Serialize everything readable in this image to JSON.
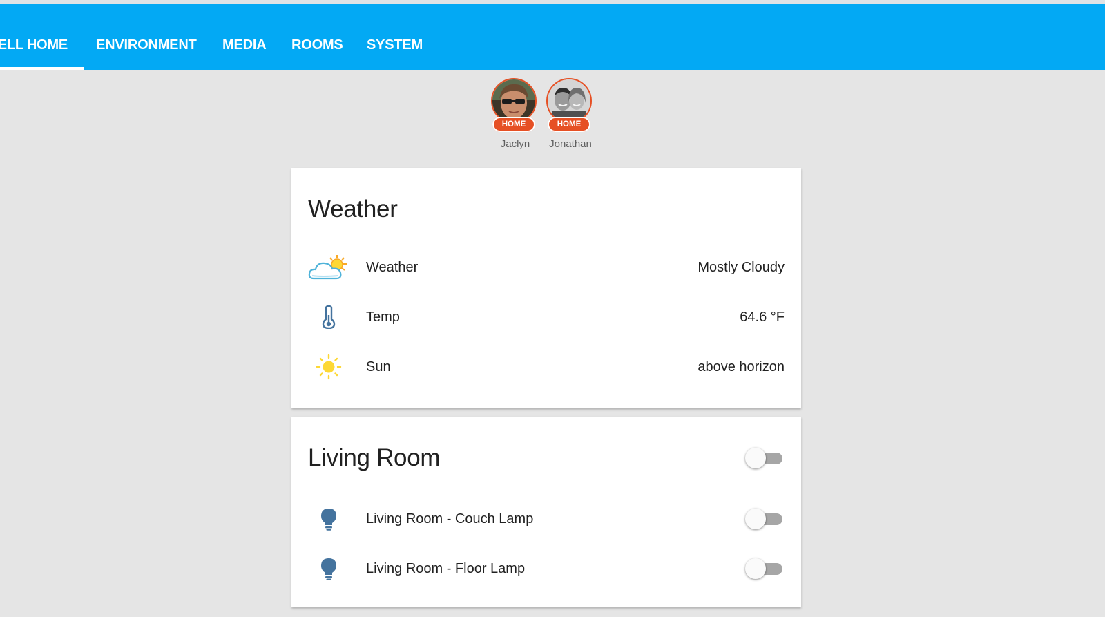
{
  "nav": {
    "tabs": [
      {
        "label": "WELL HOME",
        "active": true
      },
      {
        "label": "ENVIRONMENT"
      },
      {
        "label": "MEDIA"
      },
      {
        "label": "ROOMS"
      },
      {
        "label": "SYSTEM"
      }
    ]
  },
  "people": [
    {
      "name": "Jaclyn",
      "status": "HOME"
    },
    {
      "name": "Jonathan",
      "status": "HOME"
    }
  ],
  "weather_card": {
    "title": "Weather",
    "rows": [
      {
        "icon": "partly-cloudy-icon",
        "label": "Weather",
        "value": "Mostly Cloudy"
      },
      {
        "icon": "thermometer-icon",
        "label": "Temp",
        "value": "64.6 °F"
      },
      {
        "icon": "sun-icon",
        "label": "Sun",
        "value": "above horizon"
      }
    ]
  },
  "living_room_card": {
    "title": "Living Room",
    "group_on": false,
    "rows": [
      {
        "icon": "lightbulb-icon",
        "label": "Living Room - Couch Lamp",
        "on": false
      },
      {
        "icon": "lightbulb-icon",
        "label": "Living Room - Floor Lamp",
        "on": false
      }
    ]
  },
  "colors": {
    "header": "#03a9f4",
    "badge": "#e65024",
    "icon_blue": "#44739e",
    "sun_yellow": "#fdd835",
    "background": "#e5e5e5"
  }
}
